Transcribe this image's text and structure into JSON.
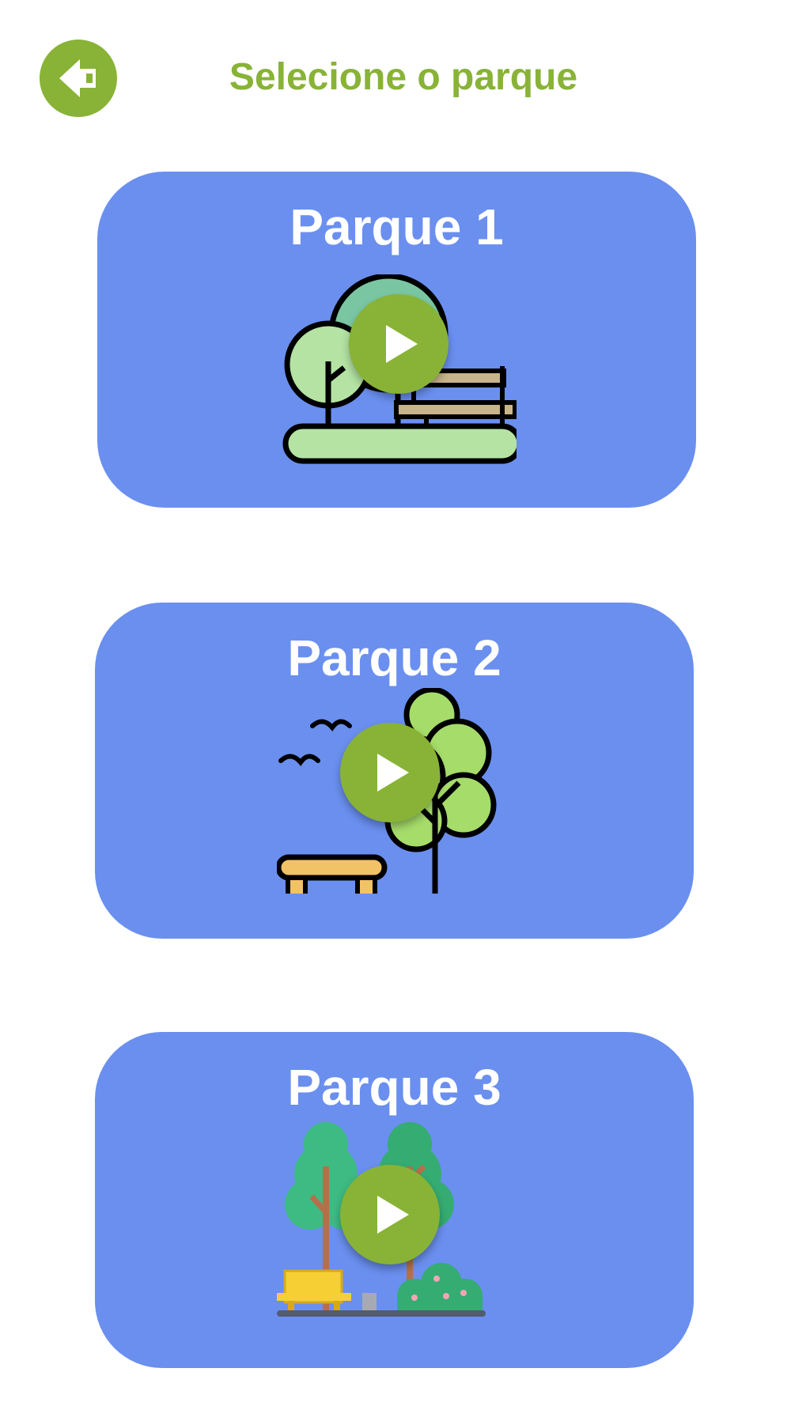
{
  "header": {
    "title": "Selecione o parque",
    "back_icon": "arrow-left-icon"
  },
  "colors": {
    "accent_green": "#88b337",
    "card_blue": "#6a8fef",
    "text_white": "#ffffff"
  },
  "parks": [
    {
      "label": "Parque 1",
      "illustration": "park-trees-bench-icon",
      "play_icon": "play-icon"
    },
    {
      "label": "Parque 2",
      "illustration": "park-tree-birds-bench-icon",
      "play_icon": "play-icon"
    },
    {
      "label": "Parque 3",
      "illustration": "park-trees-bench-bush-icon",
      "play_icon": "play-icon"
    }
  ]
}
